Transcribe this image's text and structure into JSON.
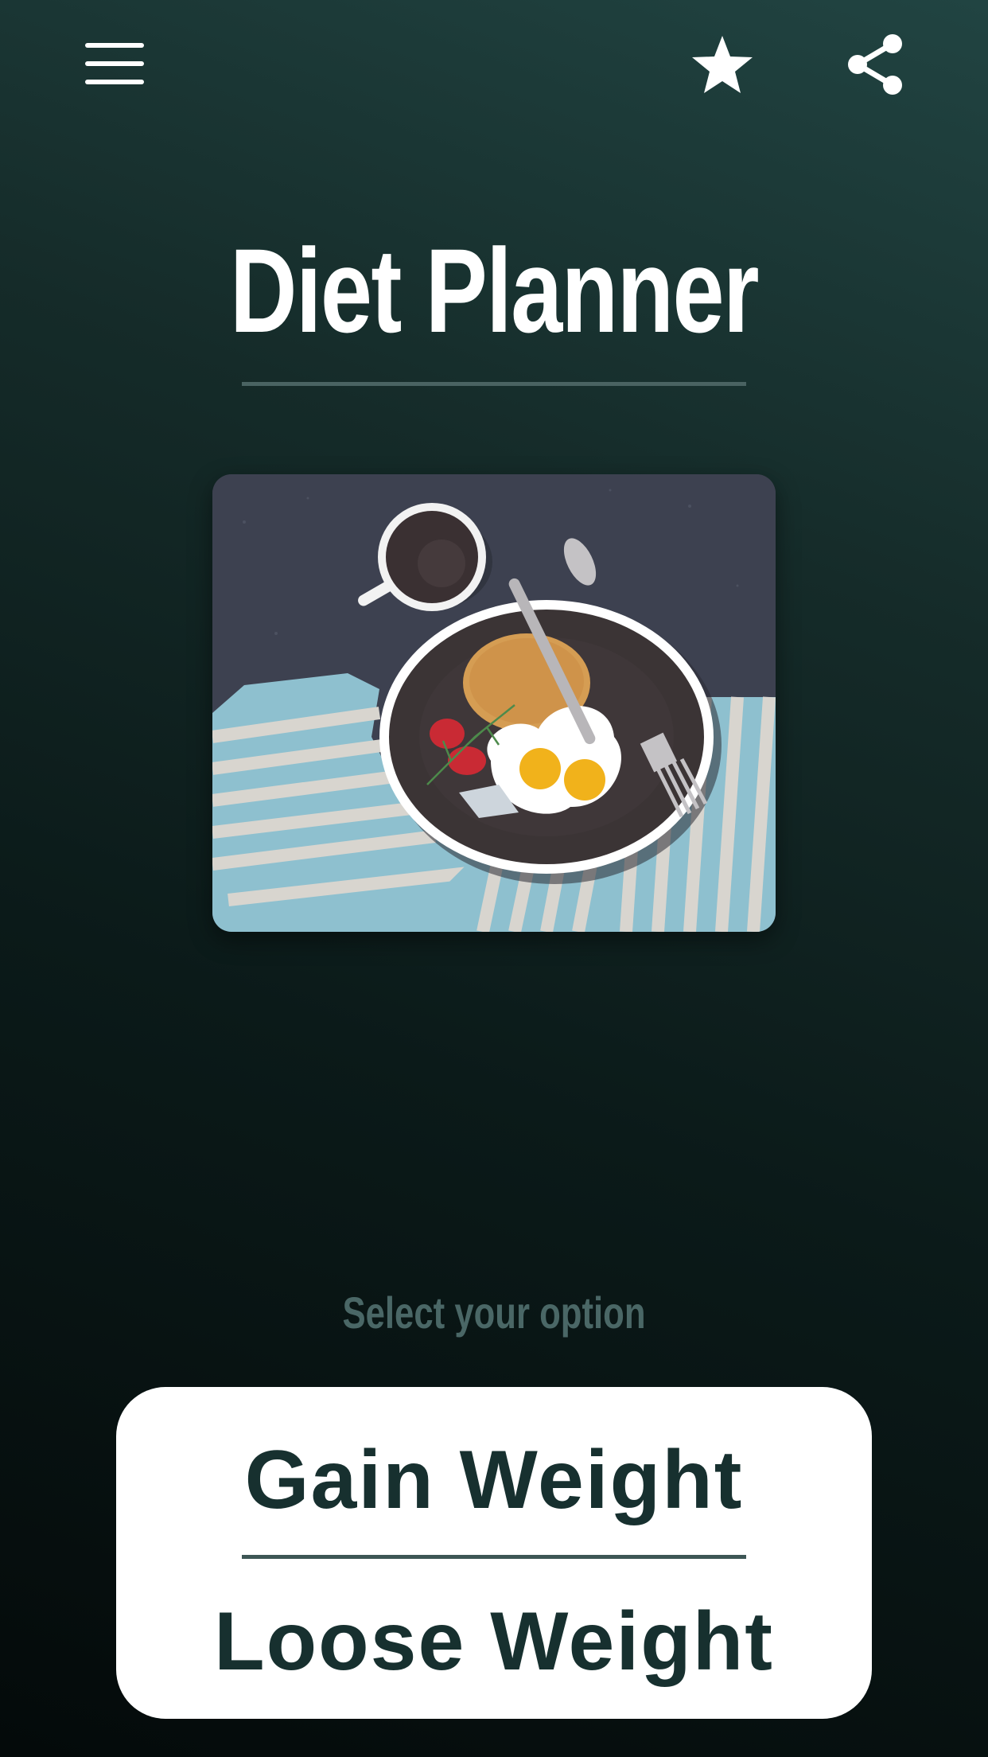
{
  "header": {
    "menu_icon": "hamburger-menu-icon",
    "favorite_icon": "star-icon",
    "share_icon": "share-icon"
  },
  "title": "Diet Planner",
  "hero_image": {
    "description_icon": "breakfast-plate-illustration"
  },
  "select_label": "Select your option",
  "options": {
    "gain": "Gain Weight",
    "loose": "Loose Weight"
  },
  "colors": {
    "background_top": "#214442",
    "background_bottom": "#040a0a",
    "option_text": "#17302f",
    "label": "#4a6766"
  }
}
